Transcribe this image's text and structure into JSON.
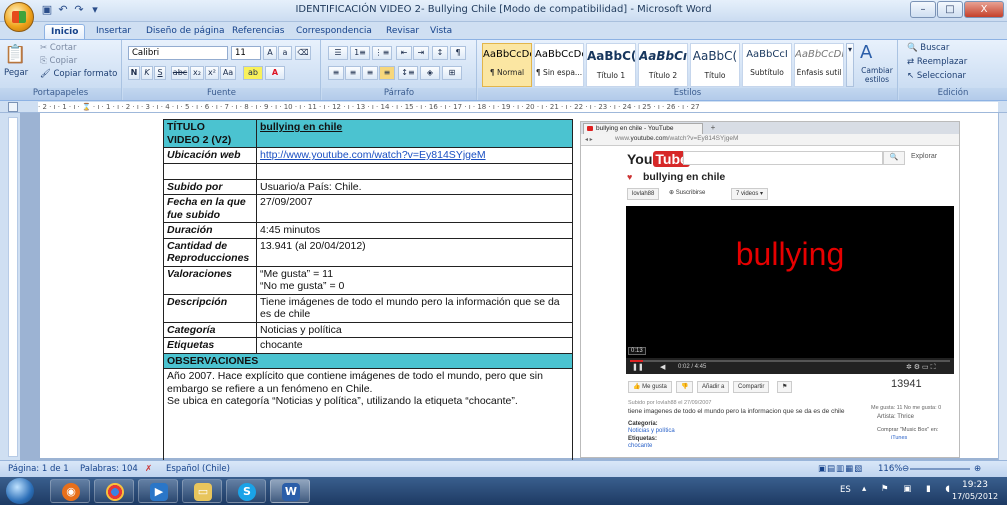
{
  "window": {
    "title": "IDENTIFICACIÓN VIDEO 2- Bullying Chile [Modo de compatibilidad] - Microsoft Word",
    "min": "–",
    "max": "□",
    "close": "X"
  },
  "tabs": [
    "Inicio",
    "Insertar",
    "Diseño de página",
    "Referencias",
    "Correspondencia",
    "Revisar",
    "Vista"
  ],
  "ribbon": {
    "clipboard": {
      "paste": "Pegar",
      "cut": "Cortar",
      "copy": "Copiar",
      "format_painter": "Copiar formato",
      "label": "Portapapeles"
    },
    "font": {
      "family": "Calibri",
      "size": "11",
      "label": "Fuente"
    },
    "paragraph": {
      "label": "Párrafo"
    },
    "styles": {
      "label": "Estilos",
      "items": [
        {
          "sample": "AaBbCcDc",
          "name": "¶ Normal"
        },
        {
          "sample": "AaBbCcDc",
          "name": "¶ Sin espa..."
        },
        {
          "sample": "AaBbC(",
          "name": "Título 1"
        },
        {
          "sample": "AaBbCı",
          "name": "Título 2"
        },
        {
          "sample": "AaBbC(",
          "name": "Título"
        },
        {
          "sample": "AaBbCcI",
          "name": "Subtítulo"
        },
        {
          "sample": "AaBbCcDı",
          "name": "Énfasis sutil"
        }
      ],
      "change": "Cambiar estilos"
    },
    "editing": {
      "find": "Buscar",
      "replace": "Reemplazar",
      "select": "Seleccionar",
      "label": "Edición"
    }
  },
  "ruler_text": "· 2 · ı · 1 · ı · ⌛ · ı · 1 · ı · 2 · ı · 3 · ı · 4 · ı · 5 · ı · 6 · ı · 7 · ı · 8 · ı · 9 · ı · 10 · ı · 11 · ı · 12 · ı · 13 · ı · 14 · ı · 15 · ı · 16 · ı · 17 · ı · 18 · ı · 19 · ı · 20 · ı · 21 · ı · 22 · ı · 23 · ı · 24 · ı 25 · ı · 26 · ı · 27",
  "table": {
    "title_label": "TÍTULO",
    "title_sub": "VIDEO 2 (V2)",
    "title_value": "bullying en chile",
    "rows": [
      {
        "label": "Ubicación web",
        "value": "http://www.youtube.com/watch?v=Ey814SYjgeM"
      },
      {
        "label": "",
        "value": ""
      },
      {
        "label": "Subido por",
        "value": "Usuario/a País: Chile."
      },
      {
        "label": "Fecha en la que fue subido",
        "value": "27/09/2007"
      },
      {
        "label": "Duración",
        "value": "4:45 minutos"
      },
      {
        "label": "Cantidad de Reproducciones",
        "value": "13.941 (al 20/04/2012)"
      },
      {
        "label": "Valoraciones",
        "value": "“Me gusta” = 11",
        "value2": "“No me gusta” = 0"
      },
      {
        "label": "Descripción",
        "value": "Tiene imágenes de todo el mundo pero la información que se da es de chile"
      },
      {
        "label": "Categoría",
        "value": "Noticias y política"
      },
      {
        "label": "Etiquetas",
        "value": "chocante"
      }
    ],
    "observations_label": "OBSERVACIONES",
    "observations_1": "Año 2007. Hace explícito que contiene imágenes de todo el mundo, pero que sin embargo se refiere a un fenómeno en Chile.",
    "observations_2": "Se ubica en categoría “Noticias y política”, utilizando la etiqueta “chocante”."
  },
  "youtube": {
    "tab_title": "bullying en chile - YouTube",
    "url_prefix": "www.",
    "url_domain": "youtube.com",
    "url_rest": "/watch?v=Ey814SYjgeM",
    "logo_you": "You",
    "logo_tube": "Tube",
    "explore": "Explorar",
    "video_title": "bullying en chile",
    "channel": "lovlah88",
    "subscribe": "Suscribirse",
    "videos": "7 videos ▾",
    "video_text": "bullying",
    "time": "0:02 / 4:45",
    "tooltip": "0:13",
    "like": "Me gusta",
    "add": "Añadir a",
    "share": "Compartir",
    "views": "13941",
    "uploaded": "Subido por lovlah88 el 27/09/2007",
    "description": "tiene imagenes de todo el mundo pero la informacion que se da es de chile",
    "likes_summary": "Me gusta: 11 No me gusta: 0",
    "artist": "Artista: Thrice",
    "buy": "Comprar \"Music Box\" en:",
    "itunes": "iTunes",
    "category_h": "Categoría:",
    "category": "Noticias y política",
    "tags_h": "Etiquetas:",
    "tags": "chocante"
  },
  "status": {
    "page": "Página: 1 de 1",
    "words": "Palabras: 104",
    "language": "Español (Chile)",
    "zoom": "116%"
  },
  "taskbar": {
    "lang": "ES",
    "time": "19:23",
    "date": "17/05/2012"
  },
  "colors": {
    "table_header": "#4bc3d0",
    "youtube_red": "#d62828"
  }
}
